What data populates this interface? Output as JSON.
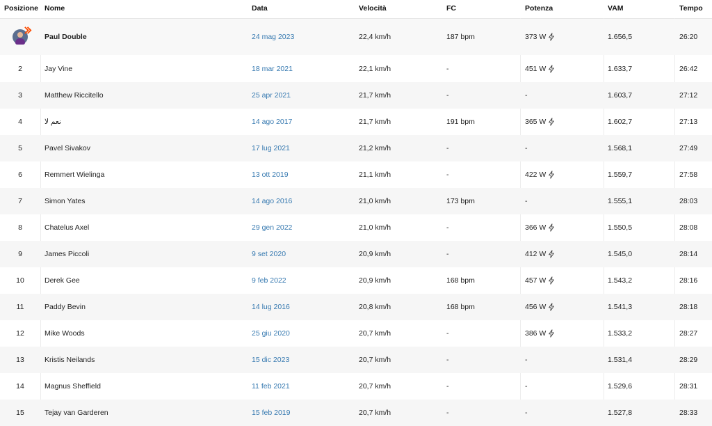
{
  "header": {
    "pos": "Posizione",
    "name": "Nome",
    "date": "Data",
    "speed": "Velocità",
    "hr": "FC",
    "power": "Potenza",
    "vam": "VAM",
    "time": "Tempo"
  },
  "current": {
    "name": "Paul Double",
    "date": "24 mag 2023",
    "speed": "22,4 km/h",
    "hr": "187 bpm",
    "power": "373 W",
    "power_estimated": true,
    "vam": "1.656,5",
    "time": "26:20"
  },
  "rows": [
    {
      "pos": "2",
      "name": "Jay Vine",
      "date": "18 mar 2021",
      "speed": "22,1 km/h",
      "hr": "-",
      "power": "451 W",
      "bolt": true,
      "vam": "1.633,7",
      "time": "26:42"
    },
    {
      "pos": "3",
      "name": "Matthew Riccitello",
      "date": "25 apr 2021",
      "speed": "21,7 km/h",
      "hr": "-",
      "power": "-",
      "bolt": false,
      "vam": "1.603,7",
      "time": "27:12"
    },
    {
      "pos": "4",
      "name": "نعم لا",
      "date": "14 ago 2017",
      "speed": "21,7 km/h",
      "hr": "191 bpm",
      "power": "365 W",
      "bolt": true,
      "vam": "1.602,7",
      "time": "27:13"
    },
    {
      "pos": "5",
      "name": "Pavel Sivakov",
      "date": "17 lug 2021",
      "speed": "21,2 km/h",
      "hr": "-",
      "power": "-",
      "bolt": false,
      "vam": "1.568,1",
      "time": "27:49"
    },
    {
      "pos": "6",
      "name": "Remmert Wielinga",
      "date": "13 ott 2019",
      "speed": "21,1 km/h",
      "hr": "-",
      "power": "422 W",
      "bolt": true,
      "vam": "1.559,7",
      "time": "27:58"
    },
    {
      "pos": "7",
      "name": "Simon Yates",
      "date": "14 ago 2016",
      "speed": "21,0 km/h",
      "hr": "173 bpm",
      "power": "-",
      "bolt": false,
      "vam": "1.555,1",
      "time": "28:03"
    },
    {
      "pos": "8",
      "name": "Chatelus Axel",
      "date": "29 gen 2022",
      "speed": "21,0 km/h",
      "hr": "-",
      "power": "366 W",
      "bolt": true,
      "vam": "1.550,5",
      "time": "28:08"
    },
    {
      "pos": "9",
      "name": "James Piccoli",
      "date": "9 set 2020",
      "speed": "20,9 km/h",
      "hr": "-",
      "power": "412 W",
      "bolt": true,
      "vam": "1.545,0",
      "time": "28:14"
    },
    {
      "pos": "10",
      "name": "Derek Gee",
      "date": "9 feb 2022",
      "speed": "20,9 km/h",
      "hr": "168 bpm",
      "power": "457 W",
      "bolt": true,
      "vam": "1.543,2",
      "time": "28:16"
    },
    {
      "pos": "11",
      "name": "Paddy Bevin",
      "date": "14 lug 2016",
      "speed": "20,8 km/h",
      "hr": "168 bpm",
      "power": "456 W",
      "bolt": true,
      "vam": "1.541,3",
      "time": "28:18"
    },
    {
      "pos": "12",
      "name": "Mike Woods",
      "date": "25 giu 2020",
      "speed": "20,7 km/h",
      "hr": "-",
      "power": "386 W",
      "bolt": true,
      "vam": "1.533,2",
      "time": "28:27"
    },
    {
      "pos": "13",
      "name": "Kristis Neilands",
      "date": "15 dic 2023",
      "speed": "20,7 km/h",
      "hr": "-",
      "power": "-",
      "bolt": false,
      "vam": "1.531,4",
      "time": "28:29"
    },
    {
      "pos": "14",
      "name": "Magnus Sheffield",
      "date": "11 feb 2021",
      "speed": "20,7 km/h",
      "hr": "-",
      "power": "-",
      "bolt": false,
      "vam": "1.529,6",
      "time": "28:31"
    },
    {
      "pos": "15",
      "name": "Tejay van Garderen",
      "date": "15 feb 2019",
      "speed": "20,7 km/h",
      "hr": "-",
      "power": "-",
      "bolt": false,
      "vam": "1.527,8",
      "time": "28:33"
    }
  ],
  "icons": {
    "power": "lightning-bolt-icon",
    "avatar_badge": "strava-subscriber-icon"
  },
  "colors": {
    "link": "#3679b0",
    "badge": "#fc4c02"
  }
}
